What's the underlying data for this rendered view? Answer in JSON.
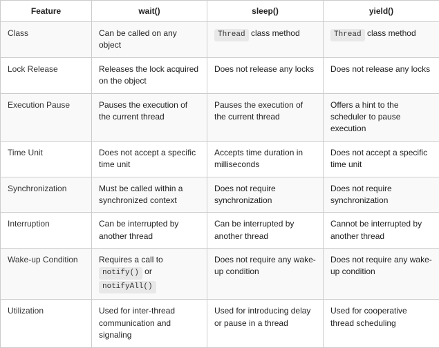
{
  "table": {
    "headers": [
      "Feature",
      "wait()",
      "sleep()",
      "yield()"
    ],
    "rows": [
      {
        "feature": "Class",
        "wait": "Can be called on any object",
        "sleep_code": "Thread",
        "sleep_text": " class method",
        "yield_code": "Thread",
        "yield_text": " class method"
      },
      {
        "feature": "Lock Release",
        "wait": "Releases the lock acquired on the object",
        "sleep": "Does not release any locks",
        "yield": "Does not release any locks"
      },
      {
        "feature": "Execution Pause",
        "wait": "Pauses the execution of the current thread",
        "sleep": "Pauses the execution of the current thread",
        "yield": "Offers a hint to the scheduler to pause execution"
      },
      {
        "feature": "Time Unit",
        "wait": "Does not accept a specific time unit",
        "sleep": "Accepts time duration in milliseconds",
        "yield": "Does not accept a specific time unit"
      },
      {
        "feature": "Synchronization",
        "wait": "Must be called within a synchronized context",
        "sleep": "Does not require synchronization",
        "yield": "Does not require synchronization"
      },
      {
        "feature": "Interruption",
        "wait": "Can be interrupted by another thread",
        "sleep": "Can be interrupted by another thread",
        "yield": "Cannot be interrupted by another thread"
      },
      {
        "feature": "Wake-up Condition",
        "wait_pre1": "Requires a call to ",
        "wait_code1": "notify()",
        "wait_mid": " or ",
        "wait_code2": "notifyAll()",
        "sleep": "Does not require any wake-up condition",
        "yield": "Does not require any wake-up condition"
      },
      {
        "feature": "Utilization",
        "wait": "Used for inter-thread communication and signaling",
        "sleep": "Used for introducing delay or pause in a thread",
        "yield": "Used for cooperative thread scheduling"
      }
    ]
  }
}
